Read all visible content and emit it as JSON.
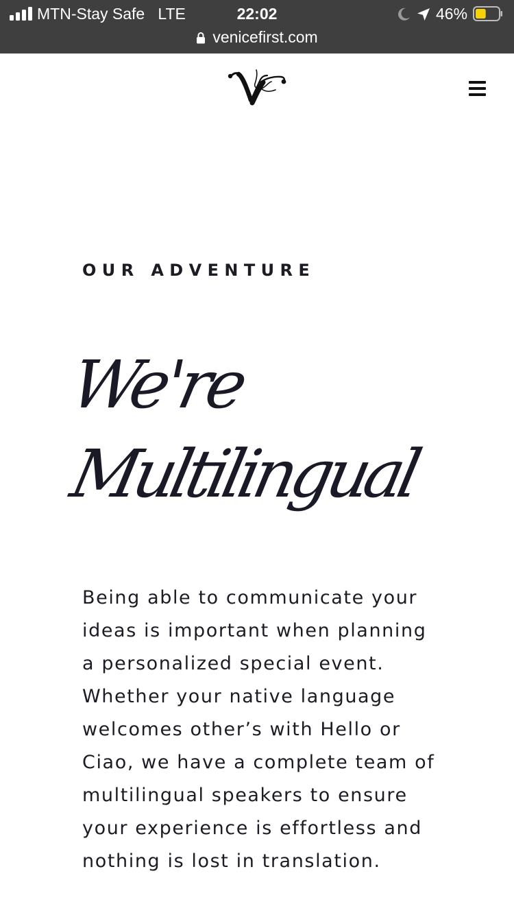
{
  "status_bar": {
    "carrier": "MTN-Stay Safe",
    "network": "LTE",
    "time": "22:02",
    "battery_percent": "46%",
    "battery_level": 0.46,
    "icons": [
      "signal-icon",
      "moon-icon",
      "location-arrow-icon",
      "battery-icon"
    ]
  },
  "url_bar": {
    "domain": "venicefirst.com",
    "secure": true
  },
  "site_header": {
    "logo_icon": "vf-monogram-logo",
    "menu_icon": "hamburger-menu-icon"
  },
  "content": {
    "eyebrow": "OUR ADVENTURE",
    "title_line1": "We're",
    "title_line2": "Multilingual",
    "body": "Being able to communicate your ideas is important when planning a personalized special event. Whether your native language welcomes other’s with Hello or Ciao, we have a complete team of multilingual speakers to ensure your experience is effortless and nothing is lost in translation."
  },
  "colors": {
    "status_bar_bg": "#3f3f3f",
    "page_bg": "#ffffff",
    "text": "#1c1c24",
    "battery_fill": "#f5d20a"
  }
}
